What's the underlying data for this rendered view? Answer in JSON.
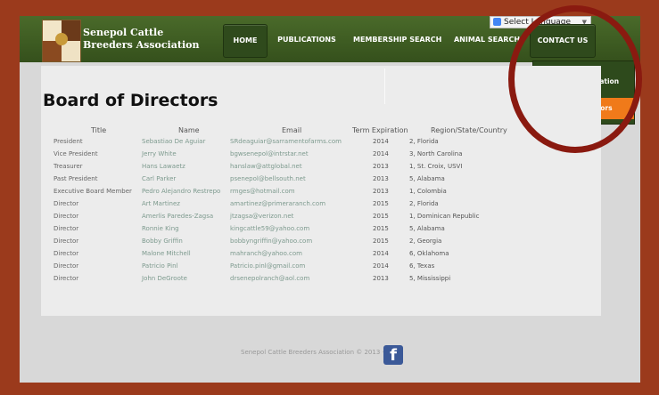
{
  "header": {
    "brand_line1": "Senepol Cattle",
    "brand_line2": "Breeders Association",
    "language_label": "Select Language",
    "nav": [
      "HOME",
      "PUBLICATIONS",
      "MEMBERSHIP SEARCH",
      "ANIMAL SEARCH",
      "CONTACT US"
    ]
  },
  "dropdown": [
    "Contact Information",
    "Board of Directors"
  ],
  "page_title": "Board of Directors",
  "table": {
    "headers": [
      "Title",
      "Name",
      "Email",
      "Term Expiration",
      "Region/State/Country"
    ],
    "rows": [
      [
        "President",
        "Sebastiao De Aguiar",
        "SRdeaguiar@sarramentofarms.com",
        "2014",
        "2, Florida"
      ],
      [
        "Vice President",
        "Jerry White",
        "bgwsenepol@intrstar.net",
        "2014",
        "3, North Carolina"
      ],
      [
        "Treasurer",
        "Hans Lawaetz",
        "hanslaw@attglobal.net",
        "2013",
        "1, St. Croix, USVI"
      ],
      [
        "Past President",
        "Carl Parker",
        "psenepol@bellsouth.net",
        "2013",
        "5, Alabama"
      ],
      [
        "Executive Board Member",
        "Pedro Alejandro Restrepo",
        "rmges@hotmail.com",
        "2013",
        "1, Colombia"
      ],
      [
        "Director",
        "Art Martinez",
        "amartinez@primeraranch.com",
        "2015",
        "2, Florida"
      ],
      [
        "Director",
        "Amerlis Paredes-Zagsa",
        "jtzagsa@verizon.net",
        "2015",
        "1, Dominican Republic"
      ],
      [
        "Director",
        "Ronnie King",
        "kingcattle59@yahoo.com",
        "2015",
        "5, Alabama"
      ],
      [
        "Director",
        "Bobby Griffin",
        "bobbyngriffin@yahoo.com",
        "2015",
        "2, Georgia"
      ],
      [
        "Director",
        "Malone Mitchell",
        "mahranch@yahoo.com",
        "2014",
        "6, Oklahoma"
      ],
      [
        "Director",
        "Patricio Pinl",
        "Patricio.pinl@gmail.com",
        "2014",
        "6, Texas"
      ],
      [
        "Director",
        "John DeGroote",
        "drsenepolranch@aol.com",
        "2013",
        "5, Mississippi"
      ]
    ]
  },
  "footer": {
    "text": "Senepol Cattle Breeders Association © 2013 •",
    "social_icon": "facebook-icon"
  },
  "colors": {
    "header_green": "#3e5c22",
    "dropdown_active": "#f07a1a",
    "outer_border": "#9b3a1c",
    "highlight_circle": "#8a1a10"
  }
}
